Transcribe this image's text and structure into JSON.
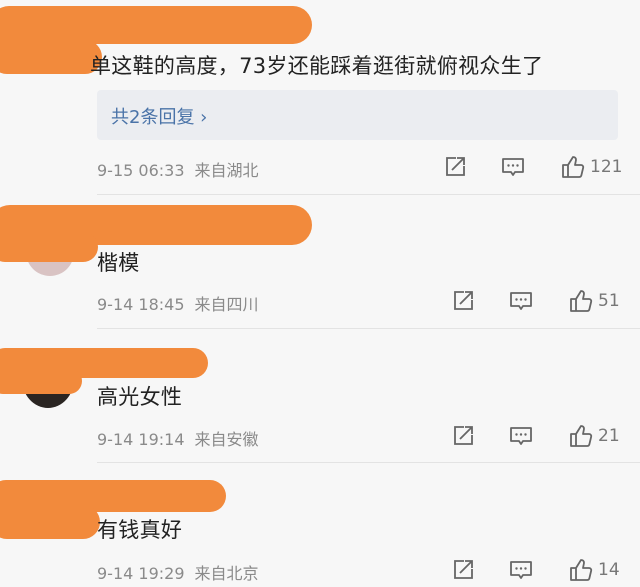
{
  "comments": [
    {
      "text": "单这鞋的高度，73岁还能踩着逛街就俯视众生了",
      "reply_link": "共2条回复 ›",
      "time": "9-15 06:33",
      "location": "来自湖北",
      "likes": "121"
    },
    {
      "text": "楷模",
      "time": "9-14 18:45",
      "location": "来自四川",
      "likes": "51"
    },
    {
      "text": "高光女性",
      "time": "9-14 19:14",
      "location": "来自安徽",
      "likes": "21"
    },
    {
      "text": "有钱真好",
      "time": "9-14 19:29",
      "location": "来自北京",
      "likes": "14"
    }
  ],
  "icons": {
    "share": "share-icon",
    "comment": "comment-icon",
    "like": "thumbs-up-icon"
  },
  "colors": {
    "redaction": "#f28a3c",
    "link": "#4a73a8",
    "meta": "#8a8a8a"
  }
}
